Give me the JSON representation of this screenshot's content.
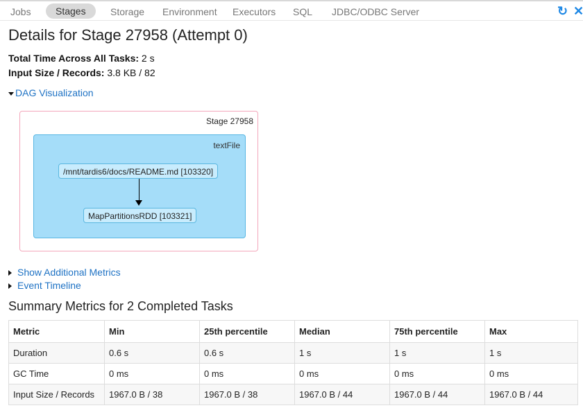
{
  "nav": {
    "tabs": [
      "Jobs",
      "Stages",
      "Storage",
      "Environment",
      "Executors",
      "SQL",
      "JDBC/ODBC Server"
    ],
    "active_tab": "Stages",
    "refresh_icon": "refresh-icon",
    "close_icon": "close-icon"
  },
  "page": {
    "title": "Details for Stage 27958 (Attempt 0)",
    "total_time_label": "Total Time Across All Tasks:",
    "total_time_value": "2 s",
    "input_label": "Input Size / Records:",
    "input_value": "3.8 KB / 82",
    "dag_toggle": "DAG Visualization",
    "show_additional_metrics": "Show Additional Metrics",
    "event_timeline": "Event Timeline"
  },
  "dag": {
    "stage_label": "Stage 27958",
    "cluster_label": "textFile",
    "node1": "/mnt/tardis6/docs/README.md [103320]",
    "node2": "MapPartitionsRDD [103321]"
  },
  "summary": {
    "title": "Summary Metrics for 2 Completed Tasks",
    "headers": [
      "Metric",
      "Min",
      "25th percentile",
      "Median",
      "75th percentile",
      "Max"
    ],
    "rows": [
      [
        "Duration",
        "0.6 s",
        "0.6 s",
        "1 s",
        "1 s",
        "1 s"
      ],
      [
        "GC Time",
        "0 ms",
        "0 ms",
        "0 ms",
        "0 ms",
        "0 ms"
      ],
      [
        "Input Size / Records",
        "1967.0 B / 38",
        "1967.0 B / 38",
        "1967.0 B / 44",
        "1967.0 B / 44",
        "1967.0 B / 44"
      ]
    ]
  },
  "colors": {
    "link": "#1e72c4",
    "stage_border": "#f3a7bb",
    "cluster_fill": "#a5ddf9",
    "node_fill": "#c8ecfd"
  }
}
